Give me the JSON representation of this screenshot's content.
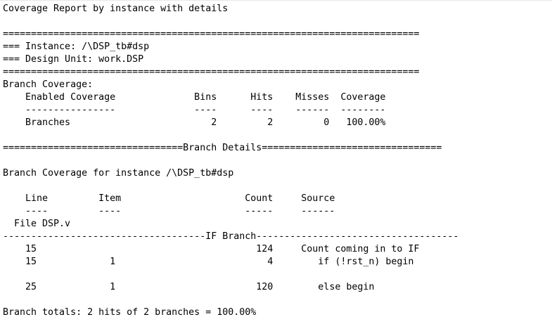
{
  "report_title": "Coverage Report by instance with details",
  "separator_long": "==========================================================================",
  "instance": {
    "instance_line": "=== Instance: /\\DSP_tb#dsp",
    "design_unit_line": "=== Design Unit: work.DSP"
  },
  "branch_coverage": {
    "heading": "Branch Coverage:",
    "header_row": "    Enabled Coverage              Bins      Hits    Misses  Coverage",
    "dash_row": "    ----------------              ----      ----    ------  --------",
    "branches_row": "    Branches                         2         2         0   100.00%"
  },
  "branch_details_banner": "================================Branch Details================================",
  "branch_instance_heading": "Branch Coverage for instance /\\DSP_tb#dsp",
  "details_table": {
    "header_row": "    Line         Item                      Count     Source ",
    "dash_row": "    ----         ----                      -----     ------ ",
    "file_row": "  File DSP.v",
    "if_branch_banner": "------------------------------------IF Branch------------------------------------",
    "rows": [
      "    15                                       124     Count coming in to IF",
      "    15             1                           4        if (!rst_n) begin",
      "",
      "    25             1                         120        else begin"
    ]
  },
  "branch_totals": "Branch totals: 2 hits of 2 branches = 100.00%"
}
